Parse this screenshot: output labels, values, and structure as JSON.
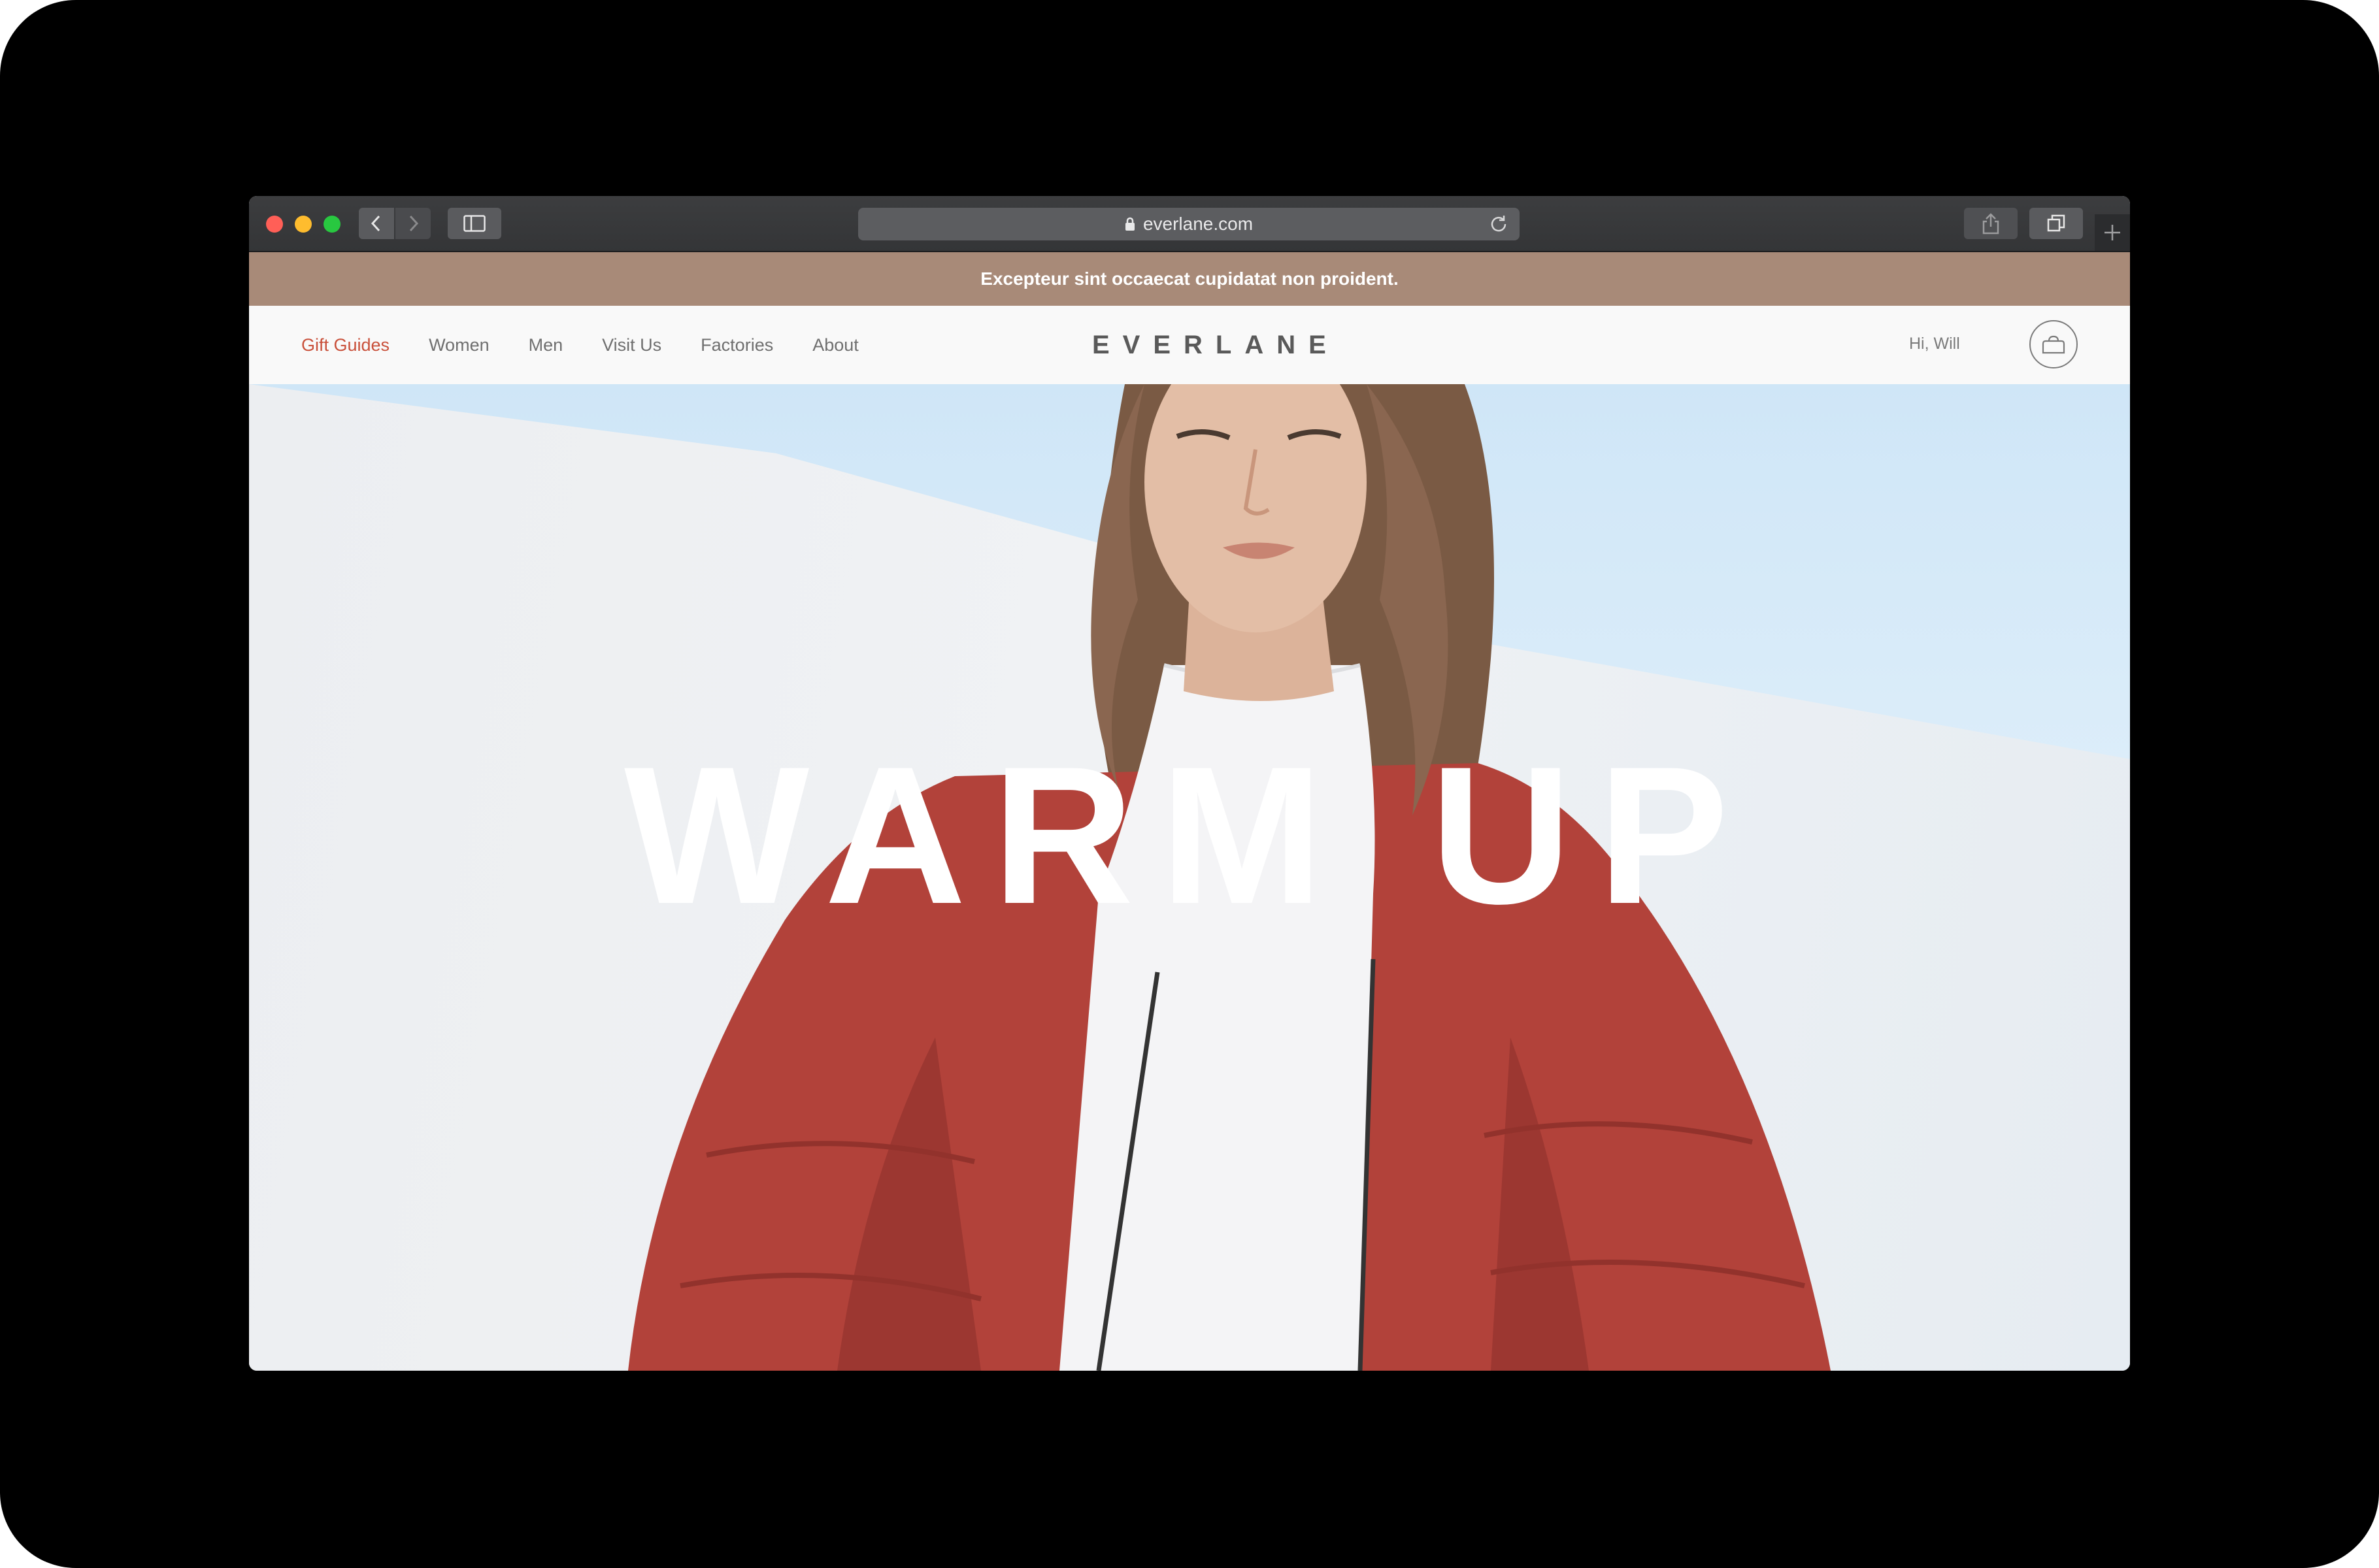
{
  "browser": {
    "url": "everlane.com"
  },
  "announcement": {
    "text": "Excepteur sint occaecat cupidatat non proident."
  },
  "nav": {
    "links": [
      {
        "label": "Gift Guides",
        "active": true
      },
      {
        "label": "Women"
      },
      {
        "label": "Men"
      },
      {
        "label": "Visit Us"
      },
      {
        "label": "Factories"
      },
      {
        "label": "About"
      }
    ],
    "logo": "EVERLANE",
    "greeting": "Hi, Will",
    "cart_icon": "bag-icon"
  },
  "hero": {
    "title": "WARM UP"
  },
  "colors": {
    "announcement_bg": "#a88a78",
    "active_link": "#c9503a",
    "jacket": "#b2423a"
  }
}
